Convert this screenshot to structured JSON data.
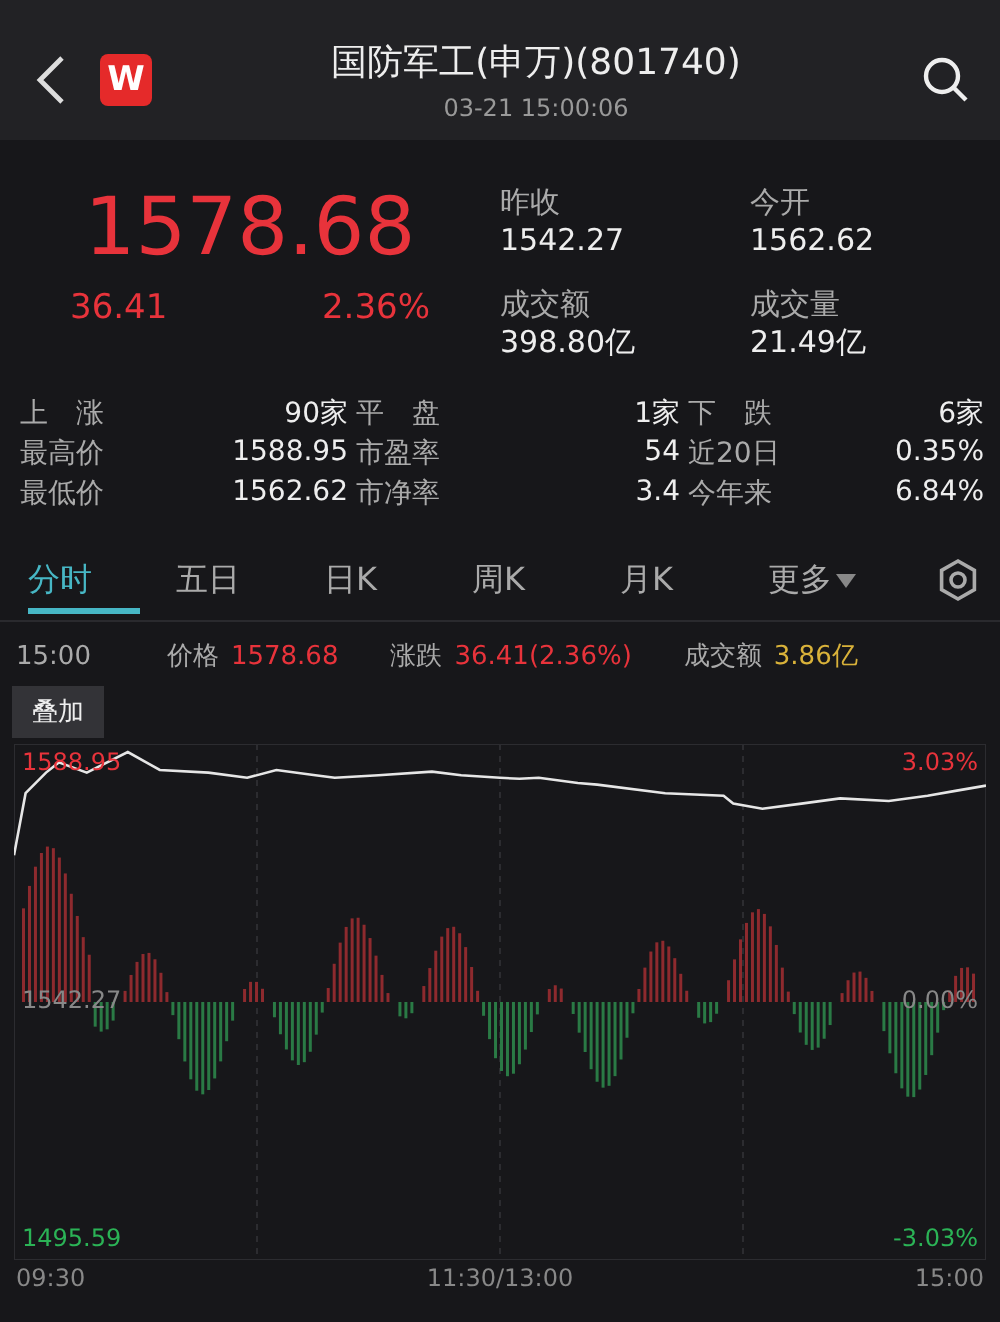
{
  "header": {
    "title": "国防军工(申万)(801740)",
    "subtitle": "03-21 15:00:06",
    "logo": "W"
  },
  "quote": {
    "price": "1578.68",
    "change": "36.41",
    "change_pct": "2.36%",
    "fields": [
      {
        "label": "昨收",
        "value": "1542.27"
      },
      {
        "label": "今开",
        "value": "1562.62"
      },
      {
        "label": "成交额",
        "value": "398.80亿"
      },
      {
        "label": "成交量",
        "value": "21.49亿"
      }
    ]
  },
  "stats": [
    [
      {
        "label": "上　涨",
        "value": "90家"
      },
      {
        "label": "平　盘",
        "value": "1家"
      },
      {
        "label": "下　跌",
        "value": "6家"
      }
    ],
    [
      {
        "label": "最高价",
        "value": "1588.95"
      },
      {
        "label": "市盈率",
        "value": "54"
      },
      {
        "label": "近20日",
        "value": "0.35%"
      }
    ],
    [
      {
        "label": "最低价",
        "value": "1562.62"
      },
      {
        "label": "市净率",
        "value": "3.4"
      },
      {
        "label": "今年来",
        "value": "6.84%"
      }
    ]
  ],
  "tabs": [
    {
      "label": "分时",
      "selected": true,
      "kind": "tab"
    },
    {
      "label": "五日",
      "selected": false,
      "kind": "tab"
    },
    {
      "label": "日K",
      "selected": false,
      "kind": "tab"
    },
    {
      "label": "周K",
      "selected": false,
      "kind": "tab"
    },
    {
      "label": "月K",
      "selected": false,
      "kind": "tab"
    },
    {
      "label": "更多",
      "selected": false,
      "kind": "menu"
    }
  ],
  "info_row": {
    "time": "15:00",
    "items": [
      {
        "label": "价格",
        "value": "1578.68",
        "kind": "price"
      },
      {
        "label": "涨跌",
        "value": "36.41(2.36%)",
        "kind": "price"
      },
      {
        "label": "成交额",
        "value": "3.86亿",
        "kind": "amount"
      }
    ]
  },
  "overlay_button": "叠加",
  "chart": {
    "left_labels": [
      "1588.95",
      "1542.27",
      "1495.59"
    ],
    "right_labels": [
      "3.03%",
      "0.00%",
      "-3.03%"
    ],
    "time_labels": [
      "09:30",
      "11:30/13:00",
      "15:00"
    ]
  }
}
